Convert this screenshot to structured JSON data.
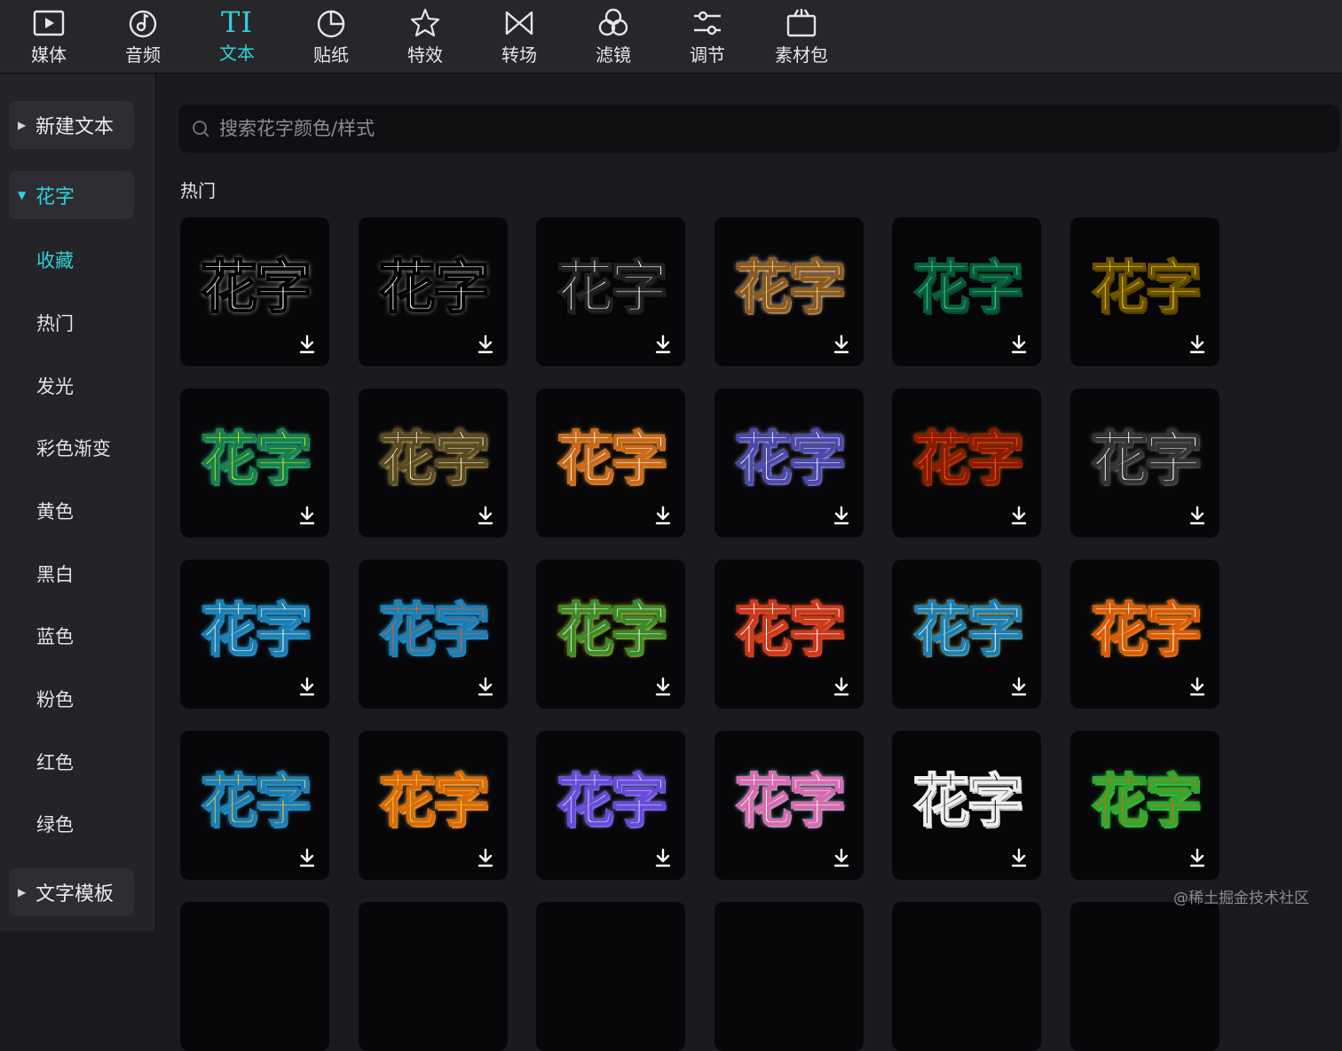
{
  "toolbar": {
    "tabs": [
      {
        "label": "媒体",
        "icon": "media-play-icon"
      },
      {
        "label": "音频",
        "icon": "audio-note-icon"
      },
      {
        "label": "文本",
        "icon": "text-ti-icon",
        "glyph": "TI",
        "active": true
      },
      {
        "label": "贴纸",
        "icon": "sticker-icon"
      },
      {
        "label": "特效",
        "icon": "effects-star-icon"
      },
      {
        "label": "转场",
        "icon": "transition-icon"
      },
      {
        "label": "滤镜",
        "icon": "filter-icon"
      },
      {
        "label": "调节",
        "icon": "adjust-sliders-icon"
      },
      {
        "label": "素材包",
        "icon": "asset-pack-icon"
      }
    ]
  },
  "sidebar": {
    "new_text": "新建文本",
    "fancy_text": "花字",
    "items": [
      "收藏",
      "热门",
      "发光",
      "彩色渐变",
      "黄色",
      "黑白",
      "蓝色",
      "粉色",
      "红色",
      "绿色"
    ],
    "active_item": "收藏",
    "text_template": "文字模板"
  },
  "search": {
    "placeholder": "搜索花字颜色/样式",
    "value": ""
  },
  "section": {
    "title": "热门"
  },
  "cards": {
    "text": "花字",
    "styles": [
      {
        "fill": "#ffffff",
        "stroke": "#000000",
        "glow": "#ffffff"
      },
      {
        "fill": "#ffffff",
        "stroke": "#000000",
        "glow": "#cccccc"
      },
      {
        "fill": "#ffffff",
        "stroke": "#222222",
        "glow": "#000000"
      },
      {
        "fill": "#f3d58d",
        "stroke": "#8a5a20",
        "glow": "#ffffff"
      },
      {
        "fill": "#34e08f",
        "stroke": "#0b5b3b",
        "glow": "#000000"
      },
      {
        "fill": "#ffd21a",
        "stroke": "#6b5100",
        "glow": "#000000"
      },
      {
        "fill": "#c8f02a",
        "stroke": "#1a7f4a",
        "glow": "#35f0c8"
      },
      {
        "fill": "#f5efd2",
        "stroke": "#5a4a20",
        "glow": "#f3d98a"
      },
      {
        "fill": "#ffffff",
        "stroke": "#c86a1a",
        "glow": "#f5b047"
      },
      {
        "fill": "#eaeaff",
        "stroke": "#4a4aa8",
        "glow": "#c8c8ff"
      },
      {
        "fill": "#ff5a18",
        "stroke": "#8a1a00",
        "glow": "#ff8a1a"
      },
      {
        "fill": "#ffffff",
        "stroke": "#333333",
        "glow": "#888888"
      },
      {
        "fill": "#f7f0cf",
        "stroke": "#1b7fb6",
        "glow": "#39b3e6"
      },
      {
        "fill": "#ff5a20",
        "stroke": "#1b7fb6",
        "glow": "#39b3e6"
      },
      {
        "fill": "#f7f0cf",
        "stroke": "#3a8a2a",
        "glow": "#f5c330"
      },
      {
        "fill": "#ffffff",
        "stroke": "#c83a1a",
        "glow": "#ff6a4a"
      },
      {
        "fill": "#f7f0cf",
        "stroke": "#1b7fb6",
        "glow": "#f5c330"
      },
      {
        "fill": "#fff7c8",
        "stroke": "#d85a0a",
        "glow": "#ffd23a"
      },
      {
        "fill": "#ffcf30",
        "stroke": "#1b7fb6",
        "glow": "#39b3e6"
      },
      {
        "fill": "#ffd23a",
        "stroke": "#d86a0a",
        "glow": "#ffe08a"
      },
      {
        "fill": "#c8d8ff",
        "stroke": "#6a4ad8",
        "glow": "#a0b8ff"
      },
      {
        "fill": "#f0fff4",
        "stroke": "#d86ab0",
        "glow": "#8af0e0"
      },
      {
        "fill": "#000000",
        "stroke": "#eeeeee",
        "glow": "#000000"
      },
      {
        "fill": "#ff5a10",
        "stroke": "#2fa830",
        "glow": "#4ad84a"
      },
      {
        "fill": "#000000",
        "stroke": "#000000",
        "glow": "#000000"
      },
      {
        "fill": "#000000",
        "stroke": "#000000",
        "glow": "#000000"
      },
      {
        "fill": "#000000",
        "stroke": "#000000",
        "glow": "#000000"
      },
      {
        "fill": "#000000",
        "stroke": "#000000",
        "glow": "#000000"
      },
      {
        "fill": "#000000",
        "stroke": "#000000",
        "glow": "#000000"
      },
      {
        "fill": "#000000",
        "stroke": "#000000",
        "glow": "#000000"
      }
    ],
    "placeholder_row": 4
  },
  "watermark": "@稀土掘金技术社区",
  "colors": {
    "accent": "#2fd3d6",
    "background": "#1b1b1f",
    "card": "#070709"
  }
}
